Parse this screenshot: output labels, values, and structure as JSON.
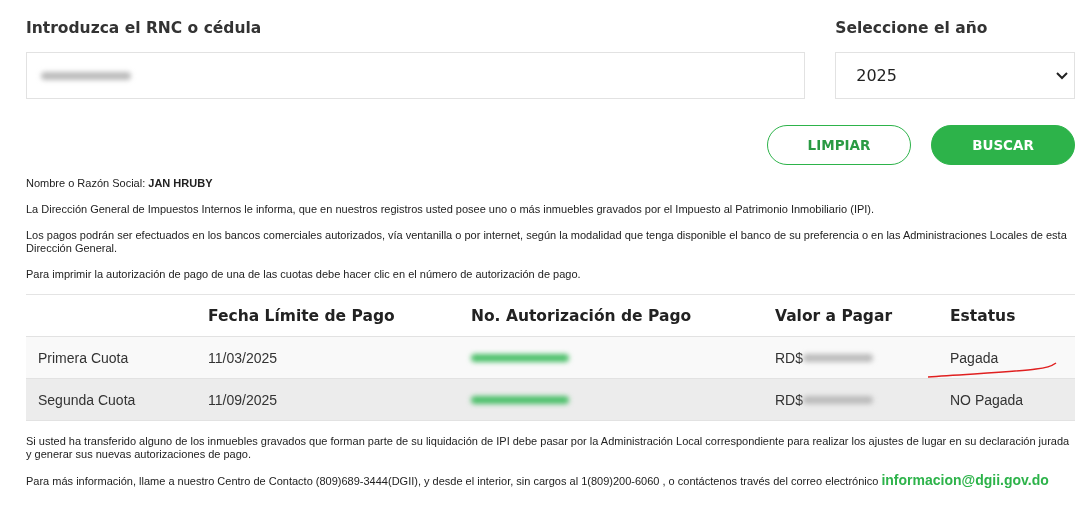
{
  "rnc_field": {
    "label": "Introduzca el RNC o cédula",
    "redacted": true
  },
  "year_select": {
    "label": "Seleccione el año",
    "value": "2025"
  },
  "buttons": [
    {
      "label": "LIMPIAR",
      "kind": "outline"
    },
    {
      "label": "BUSCAR",
      "kind": "solid"
    }
  ],
  "taxpayer": {
    "label": "Nombre o Razón Social:",
    "name": "JAN HRUBY"
  },
  "paragraphs": [
    "La Dirección General de Impuestos Internos le informa, que en nuestros registros usted posee uno o más inmuebles gravados por el Impuesto al Patrimonio Inmobiliario (IPI).",
    "Los pagos podrán ser efectuados en los bancos comerciales autorizados, vía ventanilla o por internet, según la modalidad que tenga disponible el banco de su preferencia o en las Administraciones Locales de esta Dirección General.",
    "Para imprimir la autorización de pago de una de las cuotas debe hacer clic en el número de autorización de pago."
  ],
  "table": {
    "columns": [
      "",
      "Fecha Límite de Pago",
      "No. Autorización de Pago",
      "Valor a Pagar",
      "Estatus"
    ],
    "rows": [
      {
        "cuota": "Primera Cuota",
        "fecha": "11/03/2025",
        "valor_prefix": "RD$",
        "estatus": "Pagada",
        "underlined": true
      },
      {
        "cuota": "Segunda Cuota",
        "fecha": "11/09/2025",
        "valor_prefix": "RD$",
        "estatus": "NO Pagada",
        "underlined": false
      }
    ]
  },
  "footer_note": "Si usted ha transferido alguno de los inmuebles gravados que forman parte de su liquidación de IPI debe pasar por la Administración Local correspondiente para realizar los ajustes de lugar en su declaración jurada y generar sus nuevas autorizaciones de pago.",
  "contact": {
    "text": "Para más información, llame a nuestro Centro de Contacto (809)689-3444(DGII), y desde el interior, sin cargos al 1(809)200-6060 , o contáctenos través del correo electrónico",
    "email": "informacion@dgii.gov.do"
  }
}
